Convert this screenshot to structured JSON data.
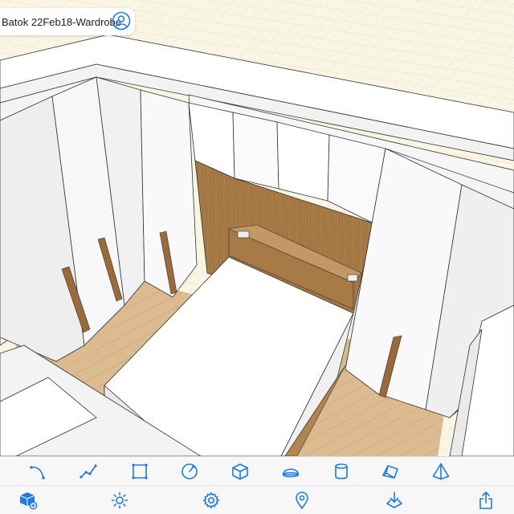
{
  "app": {
    "model_title": "Batok 22Feb18-Wardrobe"
  },
  "colors": {
    "accent": "#1e7be5",
    "grid_background": "#faf6e6",
    "wood_dark": "#a0723f",
    "floor_wood": "#d9b68a",
    "cabinet_white": "#ffffff",
    "wall_white": "#fbfbfb"
  },
  "toolbar_draw": {
    "items": [
      {
        "icon": "curve-line-icon"
      },
      {
        "icon": "polyline-icon"
      },
      {
        "icon": "rectangle-icon"
      },
      {
        "icon": "circle-icon"
      },
      {
        "icon": "box-icon"
      },
      {
        "icon": "dome-icon"
      },
      {
        "icon": "cylinder-icon"
      },
      {
        "icon": "prism-icon"
      },
      {
        "icon": "pyramid-icon"
      }
    ]
  },
  "toolbar_main": {
    "items": [
      {
        "icon": "add-object-icon"
      },
      {
        "icon": "sun-icon"
      },
      {
        "icon": "gear-icon"
      },
      {
        "icon": "location-pin-icon"
      },
      {
        "icon": "import-icon"
      },
      {
        "icon": "share-icon"
      }
    ]
  }
}
